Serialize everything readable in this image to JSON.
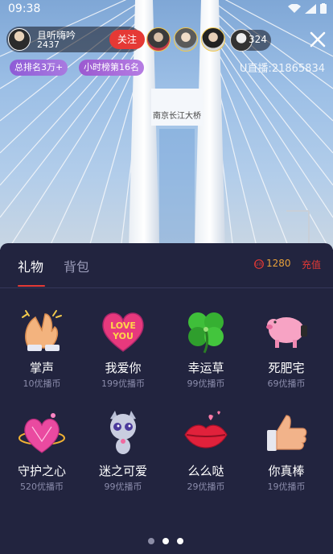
{
  "status_bar": {
    "time": "09:38"
  },
  "anchor": {
    "name": "且听嗨吟",
    "count": "2437",
    "follow_label": "关注"
  },
  "viewers": {
    "count": "324"
  },
  "tags": {
    "rank": "总排名3万+",
    "hourly": "小时榜第16名"
  },
  "room": {
    "id_text": "U直播:21865834"
  },
  "video": {
    "bridge_sign": "南京长江大桥"
  },
  "gift_panel": {
    "tabs": [
      {
        "label": "礼物",
        "active": true
      },
      {
        "label": "背包",
        "active": false
      }
    ],
    "balance": "1280",
    "coin_icon_text": "U币",
    "recharge_label": "充值",
    "gifts": [
      {
        "name": "掌声",
        "price": "10优播币",
        "icon": "clapping-hands-icon"
      },
      {
        "name": "我爱你",
        "price": "199优播币",
        "icon": "love-you-heart-icon"
      },
      {
        "name": "幸运草",
        "price": "99优播币",
        "icon": "four-leaf-clover-icon"
      },
      {
        "name": "死肥宅",
        "price": "69优播币",
        "icon": "pink-pig-icon"
      },
      {
        "name": "守护之心",
        "price": "520优播币",
        "icon": "pink-diamond-heart-icon"
      },
      {
        "name": "迷之可爱",
        "price": "99优播币",
        "icon": "cute-cat-icon"
      },
      {
        "name": "么么哒",
        "price": "29优播币",
        "icon": "kiss-lips-icon"
      },
      {
        "name": "你真棒",
        "price": "19优播币",
        "icon": "thumbs-up-icon"
      }
    ],
    "pages": 3,
    "active_page": 2
  },
  "colors": {
    "accent": "#e53935",
    "panel_bg": "#22243f",
    "coin": "#e8a13a"
  }
}
